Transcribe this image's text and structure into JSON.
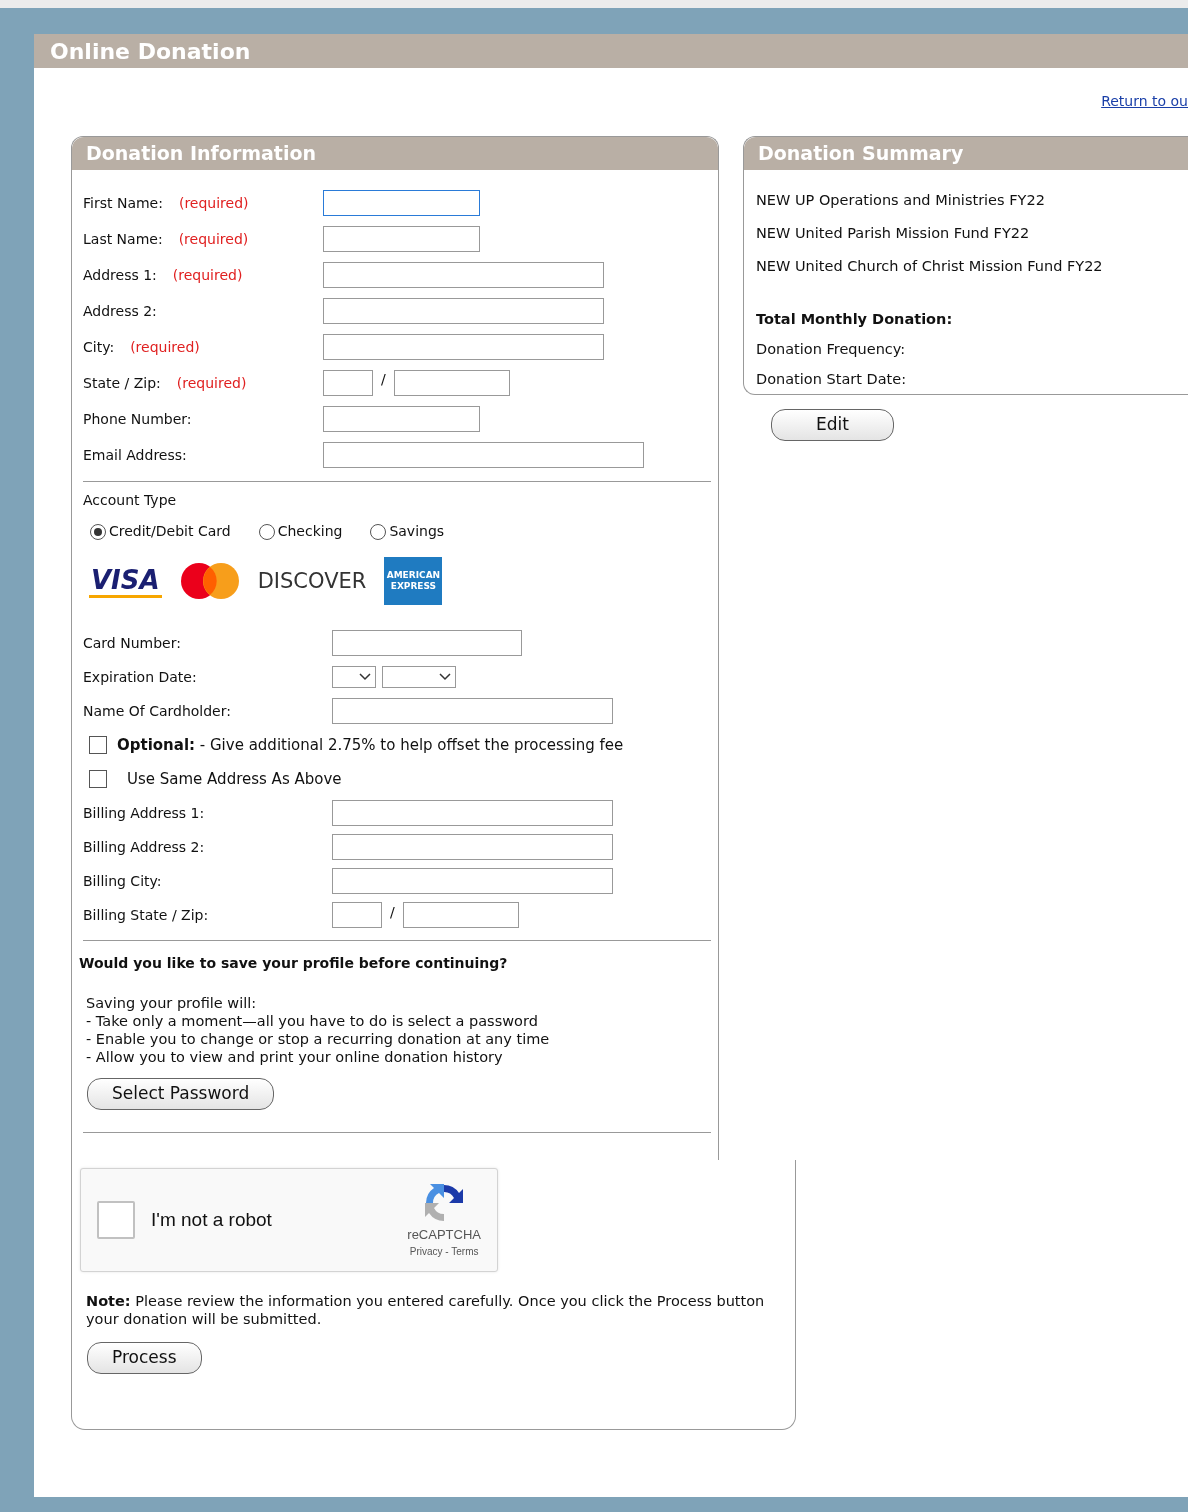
{
  "page_title": "Online Donation",
  "return_link": "Return to ou",
  "info_panel": {
    "title": "Donation Information",
    "fields": [
      {
        "label": "First Name:",
        "required": "(required)",
        "kind": "short",
        "focused": true
      },
      {
        "label": "Last Name:",
        "required": "(required)",
        "kind": "short",
        "focused": false
      },
      {
        "label": "Address 1:",
        "required": "(required)",
        "kind": "long",
        "focused": false
      },
      {
        "label": "Address 2:",
        "kind": "long",
        "focused": false
      },
      {
        "label": "City:",
        "required": "(required)",
        "kind": "long",
        "focused": false
      },
      {
        "label": "State / Zip:",
        "required": "(required)",
        "kind": "statezip",
        "separator": "/",
        "focused": false
      },
      {
        "label": "Phone Number:",
        "kind": "short",
        "focused": false
      },
      {
        "label": "Email Address:",
        "kind": "wide",
        "focused": false
      }
    ],
    "account_type": {
      "label": "Account Type",
      "options": [
        {
          "label": "Credit/Debit Card",
          "selected": true
        },
        {
          "label": "Checking",
          "selected": false
        },
        {
          "label": "Savings",
          "selected": false
        }
      ]
    },
    "card_logos": [
      {
        "kind": "visa",
        "label": "VISA"
      },
      {
        "kind": "mastercard"
      },
      {
        "kind": "discover",
        "label": "DISCOVER"
      },
      {
        "kind": "amex",
        "label": "AMERICAN EXPRESS"
      }
    ],
    "card_fields": [
      {
        "label": "Card Number:",
        "kind": "medium"
      },
      {
        "label": "Expiration Date:",
        "kind": "selects"
      },
      {
        "label": "Name Of Cardholder:",
        "kind": "long"
      }
    ],
    "options": [
      {
        "label": "**Optional:** - Give additional 2.75% to help offset the processing fee",
        "checked": false
      },
      {
        "label": "Use Same Address As Above",
        "checked": false
      }
    ],
    "billing_fields": [
      {
        "label": "Billing Address 1:",
        "kind": "long"
      },
      {
        "label": "Billing Address 2:",
        "kind": "long"
      },
      {
        "label": "Billing City:",
        "kind": "long"
      },
      {
        "label": "Billing State / Zip:",
        "kind": "statezip",
        "separator": "/"
      }
    ],
    "profile": {
      "question": "Would you like to save your profile before continuing?",
      "intro": "Saving your profile will:",
      "points": [
        "- Take only a moment—all you have to do is select a password",
        "- Enable you to change or stop a recurring donation at any time",
        "- Allow you to view and print your online donation history"
      ],
      "button": "Select Password"
    },
    "captcha": {
      "label": "I'm not a robot",
      "checked": false,
      "brand": "reCAPTCHA",
      "links": "Privacy - Terms"
    },
    "note": "**Note:** Please review the information you entered carefully. Once you click the Process button your donation will be submitted.",
    "process_button": "Process"
  },
  "summary": {
    "title": "Donation Summary",
    "funds": [
      "NEW UP Operations and Ministries FY22",
      "NEW United Parish Mission Fund FY22",
      "NEW United Church of Christ Mission Fund FY22"
    ],
    "total_label": "Total Monthly Donation:",
    "frequency_label": "Donation Frequency:",
    "start_label": "Donation Start Date:",
    "edit_button": "Edit"
  }
}
